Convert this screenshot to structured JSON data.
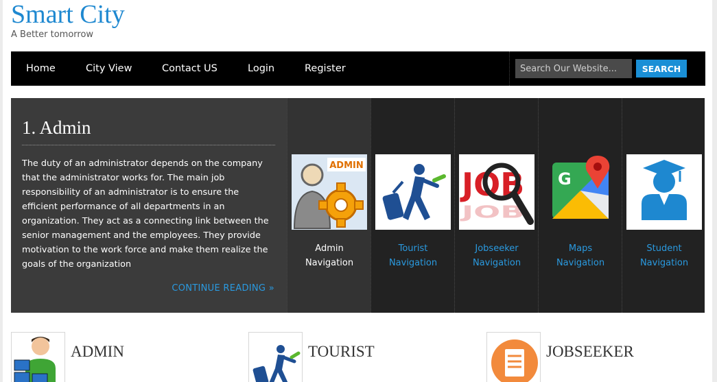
{
  "site": {
    "title": "Smart City",
    "tagline": "A Better tomorrow"
  },
  "nav": {
    "items": [
      {
        "label": "Home"
      },
      {
        "label": "City View"
      },
      {
        "label": "Contact US"
      },
      {
        "label": "Login"
      },
      {
        "label": "Register"
      }
    ]
  },
  "search": {
    "placeholder": "Search Our Website...",
    "button_label": "SEARCH"
  },
  "feature": {
    "title": "1. Admin",
    "text": "The duty of an administrator depends on the company that the administrator works for. The main job responsibility of an administrator is to ensure the efficient performance of all departments in an organization. They act as a connecting link between the senior management and the employees. They provide motivation to the work force and make them realize the goals of the organization",
    "continue_label": "CONTINUE READING »",
    "tiles": [
      {
        "label1": "Admin",
        "label2": "Navigation",
        "icon": "admin-gear-icon",
        "img_text": "ADMIN"
      },
      {
        "label1": "Tourist",
        "label2": "Navigation",
        "icon": "tourist-luggage-icon"
      },
      {
        "label1": "Jobseeker",
        "label2": "Navigation",
        "icon": "job-magnifier-icon",
        "img_text": "JOB"
      },
      {
        "label1": "Maps",
        "label2": "Navigation",
        "icon": "google-maps-icon",
        "img_text": "G"
      },
      {
        "label1": "Student",
        "label2": "Navigation",
        "icon": "student-graduate-icon"
      }
    ]
  },
  "cards": [
    {
      "title": "ADMIN",
      "icon": "admin-computers-icon"
    },
    {
      "title": "TOURIST",
      "icon": "tourist-luggage-icon"
    },
    {
      "title": "JOBSEEKER",
      "icon": "clipboard-icon"
    }
  ],
  "colors": {
    "accent": "#1a8fd6",
    "link": "#2a9ae0",
    "nav_bg": "#000000",
    "feature_bg": "#222222"
  }
}
